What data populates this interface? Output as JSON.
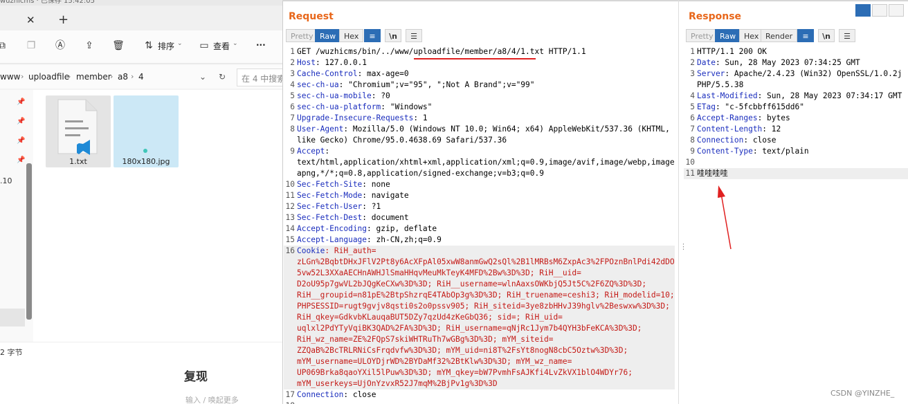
{
  "explorer": {
    "title_strip": "wuzhicms · 已保存 15:42:05",
    "toolbar": {
      "sort_label": "排序",
      "view_label": "查看",
      "more_label": "···"
    },
    "breadcrumb": [
      "www",
      "uploadfile",
      "member",
      "a8",
      "4"
    ],
    "search_placeholder": "在 4 中搜索",
    "side_text": ".10",
    "files": [
      {
        "name": "1.txt",
        "icon": "vscode-text-file-icon"
      },
      {
        "name": "180x180.jpg",
        "icon": "image-file-icon"
      }
    ],
    "status_text": "2 字节"
  },
  "below": {
    "heading": "复现",
    "input_hint": "输入 / 唤起更多"
  },
  "request": {
    "title": "Request",
    "tabs": {
      "pretty": "Pretty",
      "raw": "Raw",
      "hex": "Hex"
    },
    "lines": [
      {
        "n": "1",
        "text": "GET /wuzhicms/bin/../www/uploadfile/member/a8/4/1.txt HTTP/1.1"
      },
      {
        "n": "2",
        "key": "Host",
        "value": ": 127.0.0.1"
      },
      {
        "n": "3",
        "key": "Cache-Control",
        "value": ": max-age=0"
      },
      {
        "n": "4",
        "key": "sec-ch-ua",
        "value": ": \"Chromium\";v=\"95\", \";Not A Brand\";v=\"99\""
      },
      {
        "n": "5",
        "key": "sec-ch-ua-mobile",
        "value": ": ?0"
      },
      {
        "n": "6",
        "key": "sec-ch-ua-platform",
        "value": ": \"Windows\""
      },
      {
        "n": "7",
        "key": "Upgrade-Insecure-Requests",
        "value": ": 1"
      },
      {
        "n": "8",
        "key": "User-Agent",
        "value": ": Mozilla/5.0 (Windows NT 10.0; Win64; x64) AppleWebKit/537.36 (KHTML,"
      },
      {
        "n": "",
        "text": "like Gecko) Chrome/95.0.4638.69 Safari/537.36"
      },
      {
        "n": "9",
        "key": "Accept",
        "value": ":"
      },
      {
        "n": "",
        "text": "text/html,application/xhtml+xml,application/xml;q=0.9,image/avif,image/webp,image/"
      },
      {
        "n": "",
        "text": "apng,*/*;q=0.8,application/signed-exchange;v=b3;q=0.9"
      },
      {
        "n": "10",
        "key": "Sec-Fetch-Site",
        "value": ": none"
      },
      {
        "n": "11",
        "key": "Sec-Fetch-Mode",
        "value": ": navigate"
      },
      {
        "n": "12",
        "key": "Sec-Fetch-User",
        "value": ": ?1"
      },
      {
        "n": "13",
        "key": "Sec-Fetch-Dest",
        "value": ": document"
      },
      {
        "n": "14",
        "key": "Accept-Encoding",
        "value": ": gzip, deflate"
      },
      {
        "n": "15",
        "key": "Accept-Language",
        "value": ": zh-CN,zh;q=0.9"
      },
      {
        "n": "16",
        "key": "Cookie",
        "value": ": RiH_auth=",
        "cookie": true
      },
      {
        "n": "",
        "text": "zLGn%2BqbtDHxJFlV2Pt8y6AcXFpAl05xwW8anmGwQ2sQl%2B1lMRBsM6ZxpAc3%2FPOznBnlPdi42dDOC",
        "cookie": true
      },
      {
        "n": "",
        "text": "5vw52L3XXaAECHnAWHJlSmaHHqvMeuMkTeyK4MFD%2Bw%3D%3D; RiH__uid=",
        "cookie": true
      },
      {
        "n": "",
        "text": "D2oU95p7gwVL2bJQgKeCXw%3D%3D; RiH__username=wlnAaxsOWKbjQ5Jt5C%2F6ZQ%3D%3D;",
        "cookie": true
      },
      {
        "n": "",
        "text": "RiH__groupid=n81pE%2BtpShzrqE4TAbOp3g%3D%3D; RiH_truename=ceshi3; RiH_modelid=10;",
        "cookie": true
      },
      {
        "n": "",
        "text": "PHPSESSID=rugt9gvjv8qsti0s2o0pssv905; RiH_siteid=3ye8zbHHvJ39hglv%2Beswxw%3D%3D;",
        "cookie": true
      },
      {
        "n": "",
        "text": "RiH_qkey=GdkvbKLauqaBUT5DZy7qzUd4zKeGbQ36; sid=; RiH_uid=",
        "cookie": true
      },
      {
        "n": "",
        "text": "uqlxl2PdYTyVqiBK3QAD%2FA%3D%3D; RiH_username=qNjRc1Jym7b4QYH3bFeKCA%3D%3D;",
        "cookie": true
      },
      {
        "n": "",
        "text": "RiH_wz_name=ZE%2FQpS7skiWHTRuTh7wGBg%3D%3D; mYM_siteid=",
        "cookie": true
      },
      {
        "n": "",
        "text": "ZZQaB%2BcTRLRNiCsFrqdvfw%3D%3D; mYM_uid=ni8T%2FsYt8nogN8cbC5Oztw%3D%3D;",
        "cookie": true
      },
      {
        "n": "",
        "text": "mYM_username=ULOYDjrWD%2BYDaMf32%2BtKlw%3D%3D; mYM_wz_name=",
        "cookie": true
      },
      {
        "n": "",
        "text": "UP069Brka8qaoYXil5lPuw%3D%3D; mYM_qkey=bW7PvmhFsAJKfi4LvZkVX1blO4WDYr76;",
        "cookie": true
      },
      {
        "n": "",
        "text": "mYM_userkeys=UjOnYzvxR52J7mqM%2BjPv1g%3D%3D",
        "cookie": true
      },
      {
        "n": "17",
        "key": "Connection",
        "value": ": close"
      },
      {
        "n": "18",
        "text": ""
      }
    ]
  },
  "response": {
    "title": "Response",
    "tabs": {
      "pretty": "Pretty",
      "raw": "Raw",
      "hex": "Hex",
      "render": "Render"
    },
    "lines": [
      {
        "n": "1",
        "text": "HTTP/1.1 200 OK"
      },
      {
        "n": "2",
        "key": "Date",
        "value": ": Sun, 28 May 2023 07:34:25 GMT"
      },
      {
        "n": "3",
        "key": "Server",
        "value": ": Apache/2.4.23 (Win32) OpenSSL/1.0.2j"
      },
      {
        "n": "",
        "text": "PHP/5.5.38"
      },
      {
        "n": "4",
        "key": "Last-Modified",
        "value": ": Sun, 28 May 2023 07:34:17 GMT"
      },
      {
        "n": "5",
        "key": "ETag",
        "value": ": \"c-5fcbbff615dd6\""
      },
      {
        "n": "6",
        "key": "Accept-Ranges",
        "value": ": bytes"
      },
      {
        "n": "7",
        "key": "Content-Length",
        "value": ": 12"
      },
      {
        "n": "8",
        "key": "Connection",
        "value": ": close"
      },
      {
        "n": "9",
        "key": "Content-Type",
        "value": ": text/plain"
      },
      {
        "n": "10",
        "text": ""
      },
      {
        "n": "11",
        "text": "哇哇哇哇"
      }
    ]
  },
  "watermark": "CSDN @YINZHE_",
  "colors": {
    "accent": "#2c6db5",
    "title": "#e8671b",
    "header_key": "#1a2dbd",
    "cookie": "#c41a16",
    "annotation": "#e02020"
  }
}
